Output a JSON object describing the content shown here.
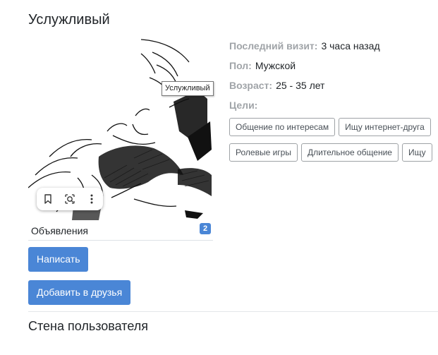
{
  "profile": {
    "name": "Услужливый"
  },
  "photo": {
    "tooltip": "Услужливый"
  },
  "lens_toolbar": {
    "icons": [
      "bookmark-icon",
      "lens-icon",
      "more-vertical-icon"
    ]
  },
  "ads": {
    "label": "Объявления",
    "count": "2"
  },
  "buttons": {
    "write": "Написать",
    "add_friend": "Добавить в друзья"
  },
  "info": {
    "last_visit_label": "Последний визит:",
    "last_visit_value": "3 часа назад",
    "gender_label": "Пол:",
    "gender_value": "Мужской",
    "age_label": "Возраст:",
    "age_value": "25 - 35 лет",
    "goals_label": "Цели:"
  },
  "goals": [
    "Общение по интересам",
    "Ищу интернет-друга",
    "Ролевые игры",
    "Длительное общение",
    "Ищу"
  ],
  "wall": {
    "title": "Стена пользователя"
  },
  "colors": {
    "accent": "#4a86d6",
    "muted_label": "#a0a4a8",
    "tag_border": "#9ea2a6"
  }
}
